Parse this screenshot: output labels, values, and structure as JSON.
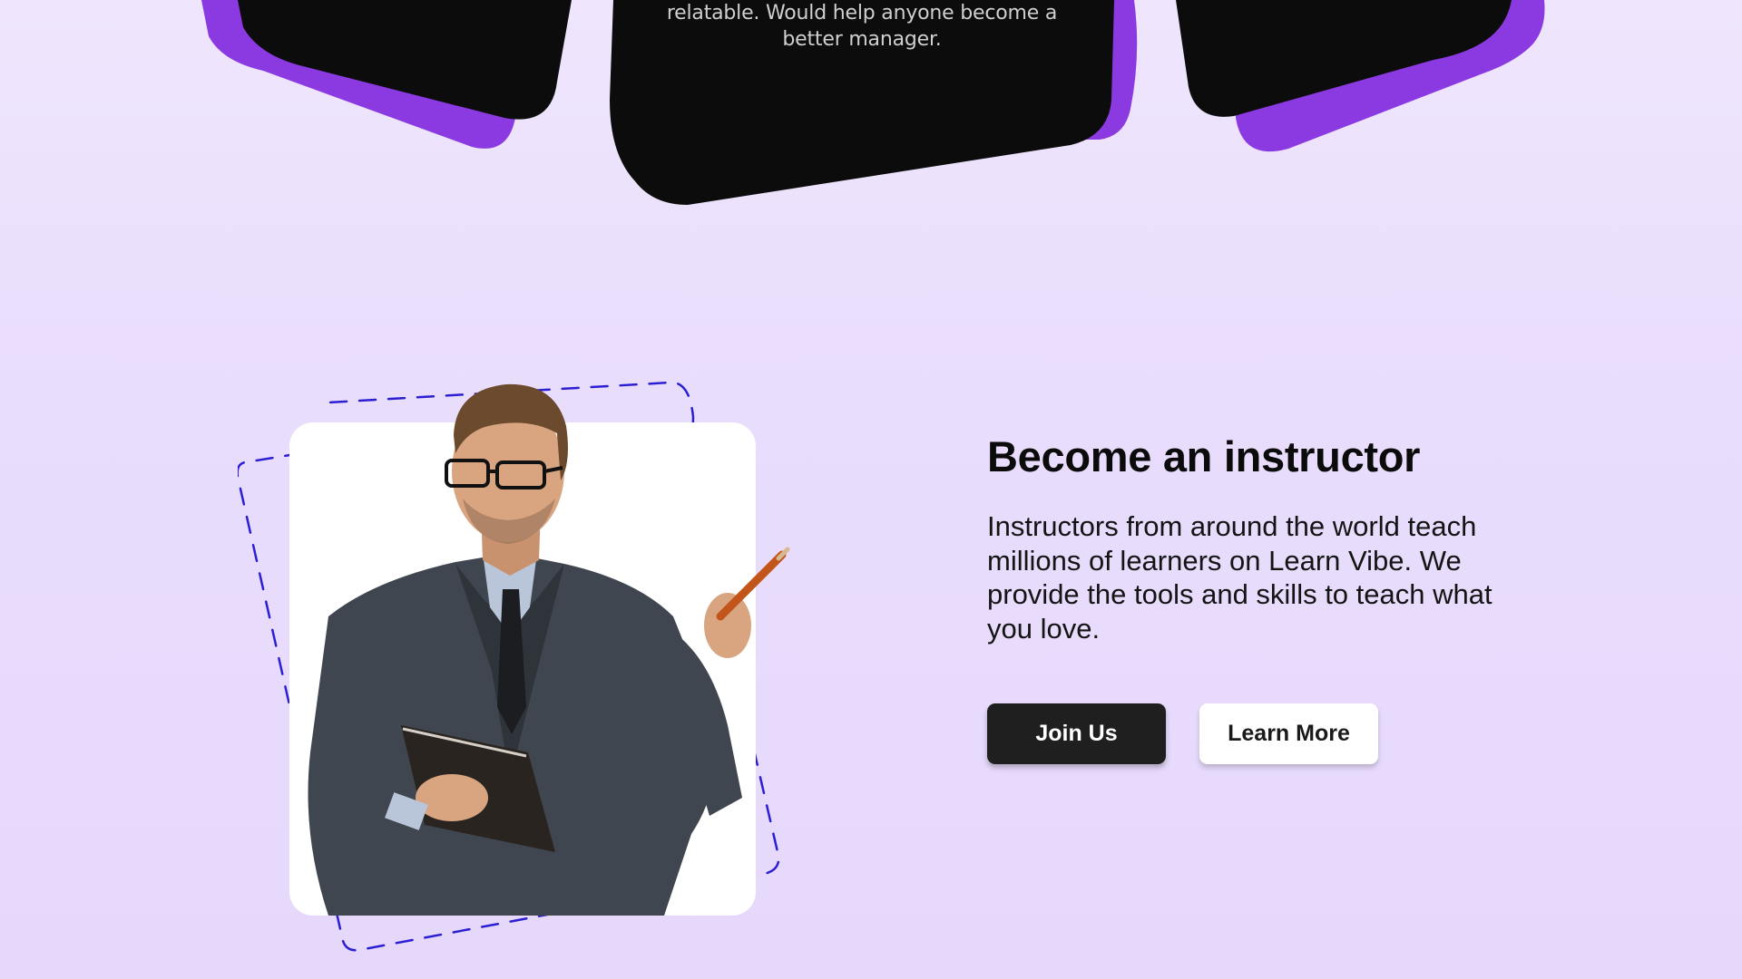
{
  "testimonials": {
    "visible_quote": "relatable. Would help anyone become a better manager."
  },
  "instructor_section": {
    "heading": "Become an instructor",
    "description": "Instructors from around the world teach millions of learners on Learn Vibe. We provide the tools and skills to teach what you love.",
    "buttons": {
      "join_label": "Join Us",
      "learn_more_label": "Learn More"
    }
  },
  "colors": {
    "background": "#ebe0fc",
    "card_dark": "#0c0c0c",
    "card_accent": "#8a3ae0",
    "dashed_frame": "#2b1fd4",
    "primary_button": "#1f1f1f",
    "secondary_button": "#ffffff"
  },
  "icons": {
    "photo": "instructor-photo"
  }
}
